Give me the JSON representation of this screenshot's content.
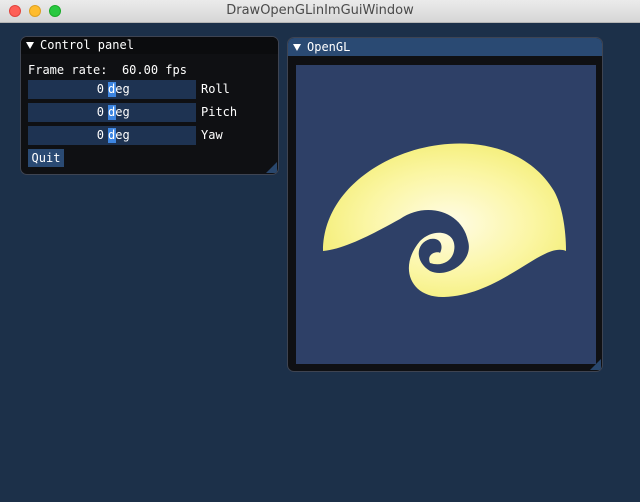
{
  "window": {
    "title": "DrawOpenGLinImGuiWindow"
  },
  "control_panel": {
    "title": "Control panel",
    "frame_rate_label": "Frame rate:",
    "frame_rate_value": "60.00 fps",
    "sliders": [
      {
        "value": "0",
        "unit": "deg",
        "label": "Roll"
      },
      {
        "value": "0",
        "unit": "deg",
        "label": "Pitch"
      },
      {
        "value": "0",
        "unit": "deg",
        "label": "Yaw"
      }
    ],
    "quit_label": "Quit"
  },
  "opengl": {
    "title": "OpenGL"
  },
  "colors": {
    "background": "#1c3049",
    "panel": "#0f1013",
    "header_active": "#2a4a73",
    "slider_frame": "#1e3352",
    "slider_grab": "#3d85e0",
    "canvas": "#2e4067",
    "shape_fill": "#f6f07a"
  }
}
